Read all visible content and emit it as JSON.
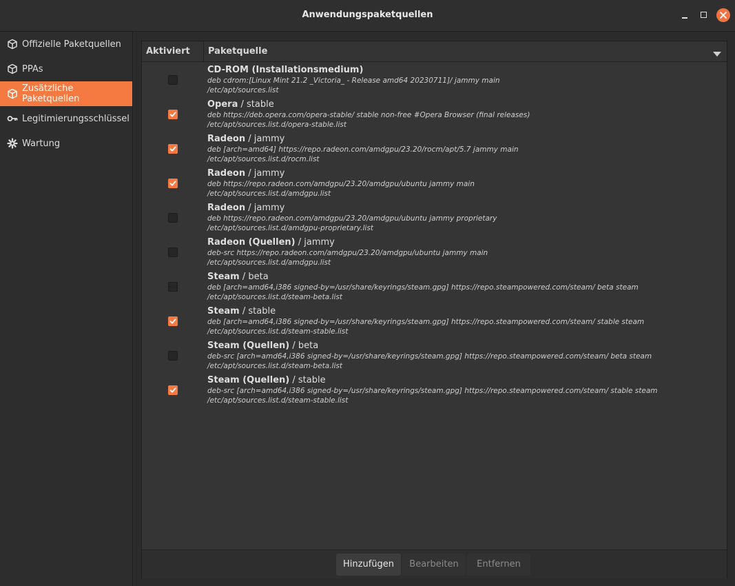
{
  "window": {
    "title": "Anwendungspaketquellen"
  },
  "sidebar": {
    "items": [
      {
        "label": "Offizielle Paketquellen",
        "icon": "package-icon"
      },
      {
        "label": "PPAs",
        "icon": "package-icon"
      },
      {
        "label": "Zusätzliche Paketquellen",
        "icon": "package-icon",
        "active": true
      },
      {
        "label": "Legitimierungsschlüssel",
        "icon": "key-icon"
      },
      {
        "label": "Wartung",
        "icon": "gear-icon"
      }
    ]
  },
  "table": {
    "headers": {
      "enabled": "Aktiviert",
      "source": "Paketquelle"
    },
    "rows": [
      {
        "enabled": false,
        "name": "CD-ROM (Installationsmedium)",
        "suffix": "",
        "line": "deb cdrom:[Linux Mint 21.2 _Victoria_ - Release amd64 20230711]/ jammy main",
        "file": "/etc/apt/sources.list"
      },
      {
        "enabled": true,
        "name": "Opera",
        "suffix": " / stable",
        "line": "deb https://deb.opera.com/opera-stable/ stable non-free #Opera Browser (final releases)",
        "file": "/etc/apt/sources.list.d/opera-stable.list"
      },
      {
        "enabled": true,
        "name": "Radeon",
        "suffix": " / jammy",
        "line": "deb [arch=amd64] https://repo.radeon.com/amdgpu/23.20/rocm/apt/5.7 jammy main",
        "file": "/etc/apt/sources.list.d/rocm.list"
      },
      {
        "enabled": true,
        "name": "Radeon",
        "suffix": " / jammy",
        "line": "deb https://repo.radeon.com/amdgpu/23.20/amdgpu/ubuntu jammy main",
        "file": "/etc/apt/sources.list.d/amdgpu.list"
      },
      {
        "enabled": false,
        "name": "Radeon",
        "suffix": " / jammy",
        "line": "deb https://repo.radeon.com/amdgpu/23.20/amdgpu/ubuntu jammy proprietary",
        "file": "/etc/apt/sources.list.d/amdgpu-proprietary.list"
      },
      {
        "enabled": false,
        "name": "Radeon (Quellen)",
        "suffix": " / jammy",
        "line": "deb-src https://repo.radeon.com/amdgpu/23.20/amdgpu/ubuntu jammy main",
        "file": "/etc/apt/sources.list.d/amdgpu.list"
      },
      {
        "enabled": false,
        "name": "Steam",
        "suffix": " / beta",
        "line": "deb [arch=amd64,i386 signed-by=/usr/share/keyrings/steam.gpg] https://repo.steampowered.com/steam/ beta steam",
        "file": "/etc/apt/sources.list.d/steam-beta.list"
      },
      {
        "enabled": true,
        "name": "Steam",
        "suffix": " / stable",
        "line": "deb [arch=amd64,i386 signed-by=/usr/share/keyrings/steam.gpg] https://repo.steampowered.com/steam/ stable steam",
        "file": "/etc/apt/sources.list.d/steam-stable.list"
      },
      {
        "enabled": false,
        "name": "Steam (Quellen)",
        "suffix": " / beta",
        "line": "deb-src [arch=amd64,i386 signed-by=/usr/share/keyrings/steam.gpg] https://repo.steampowered.com/steam/ beta steam",
        "file": "/etc/apt/sources.list.d/steam-beta.list"
      },
      {
        "enabled": true,
        "name": "Steam (Quellen)",
        "suffix": " / stable",
        "line": "deb-src [arch=amd64,i386 signed-by=/usr/share/keyrings/steam.gpg] https://repo.steampowered.com/steam/ stable steam",
        "file": "/etc/apt/sources.list.d/steam-stable.list"
      }
    ]
  },
  "footer": {
    "add_label": "Hinzufügen",
    "edit_label": "Bearbeiten",
    "remove_label": "Entfernen"
  },
  "colors": {
    "accent": "#f47a42",
    "background": "#2b2b2b",
    "panel": "#353535"
  }
}
